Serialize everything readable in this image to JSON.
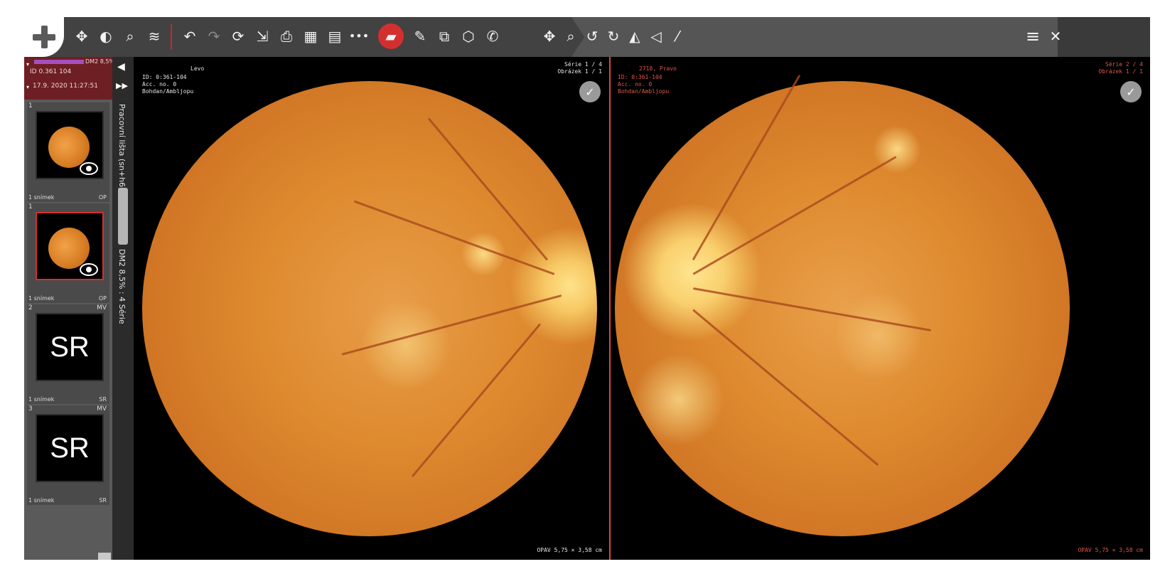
{
  "toolbar": {
    "main_button": "+",
    "icons": {
      "move": "✥",
      "contrast": "◐",
      "zoom": "⌕",
      "stack": "≋",
      "undo": "↶",
      "redo": "↷",
      "refresh": "⟳",
      "export": "⇲",
      "print": "⎙",
      "layout_grid": "▦",
      "layout_list": "▤",
      "more": "•••",
      "image_active": "▰",
      "draw": "✎",
      "copy": "⧉",
      "cube": "⬡",
      "phone": "✆",
      "move2": "✥",
      "zoom2": "⌕",
      "rotate_left": "↺",
      "rotate_right": "↻",
      "flip": "◭",
      "mirror": "◁",
      "wand": "⁄",
      "menu": "≡",
      "close": "✕"
    }
  },
  "sidebar": {
    "patient_name": "DM2 8,5%",
    "patient_id": "ID 0.361 104",
    "study_date": "17.9. 2020 11:27:51",
    "thumbnails": [
      {
        "index": "1",
        "modality": "",
        "images": "1 snímek",
        "type": "OP",
        "content": "fundus"
      },
      {
        "index": "1",
        "modality": "",
        "images": "1 snímek",
        "type": "OP",
        "content": "fundus"
      },
      {
        "index": "2",
        "modality": "MV",
        "images": "1 snímek",
        "type": "SR",
        "content": "SR"
      },
      {
        "index": "3",
        "modality": "MV",
        "images": "1 snímek",
        "type": "SR",
        "content": "SR"
      }
    ]
  },
  "strip": {
    "collapse_arrow": "◀",
    "expand_arrow": "▶▶",
    "label_top": "Pracovní lišta (sn+h6)",
    "label_bottom": "DM2 8,5% : 4 Série"
  },
  "viewports": {
    "left": {
      "patient": "Levo",
      "id_line": "ID: 0:361-104",
      "acc_line": "Acc. no. 0",
      "desc_line": "Bohdan/Ambljopu",
      "series": "Série 1 / 4",
      "image": "Obrázek 1 / 1",
      "footer": "OPAV 5,75 × 3,58 cm"
    },
    "right": {
      "patient": "2718, Pravo",
      "id_line": "ID: 0:361-104",
      "acc_line": "Acc. no. 0",
      "desc_line": "Bohdan/Ambljopu",
      "series": "Série 2 / 4",
      "image": "Obrázek 1 / 1",
      "footer": "OPAV 5,75 × 3,58 cm"
    },
    "check_icon": "✓"
  },
  "colors": {
    "accent_red": "#d32f2f",
    "toolbar_bg": "#424242",
    "sidebar_header": "#6e1f23"
  }
}
